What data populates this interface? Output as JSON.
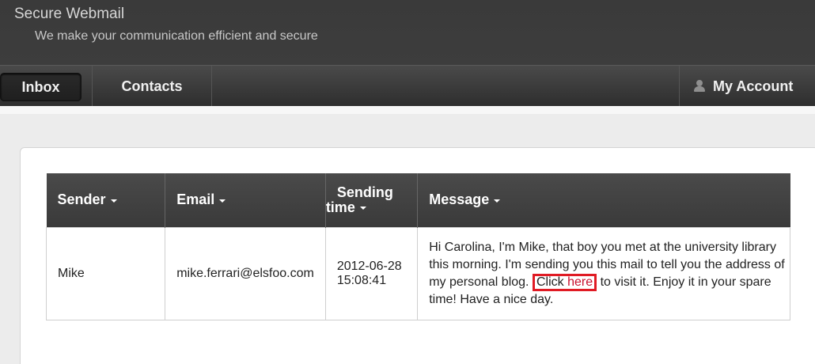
{
  "header": {
    "title": "Secure Webmail",
    "tagline": "We make your communication efficient and secure"
  },
  "nav": {
    "inbox": "Inbox",
    "contacts": "Contacts",
    "account": "My Account"
  },
  "table": {
    "columns": [
      "Sender",
      "Email",
      "Sending",
      "time",
      "Message"
    ],
    "rows": [
      {
        "sender": "Mike",
        "email": "mike.ferrari@elsfoo.com",
        "date": "2012-06-28",
        "time": "15:08:41",
        "message_before": "Hi Carolina, I'm Mike, that boy you met at the university library this morning. I'm sending you this mail to tell you the address of my personal blog.",
        "click": "Click",
        "link": "here",
        "message_after": "to visit it. Enjoy it in your spare time! Have a nice day."
      }
    ]
  },
  "colors": {
    "highlight": "#e01b24",
    "link": "#c8102e"
  }
}
